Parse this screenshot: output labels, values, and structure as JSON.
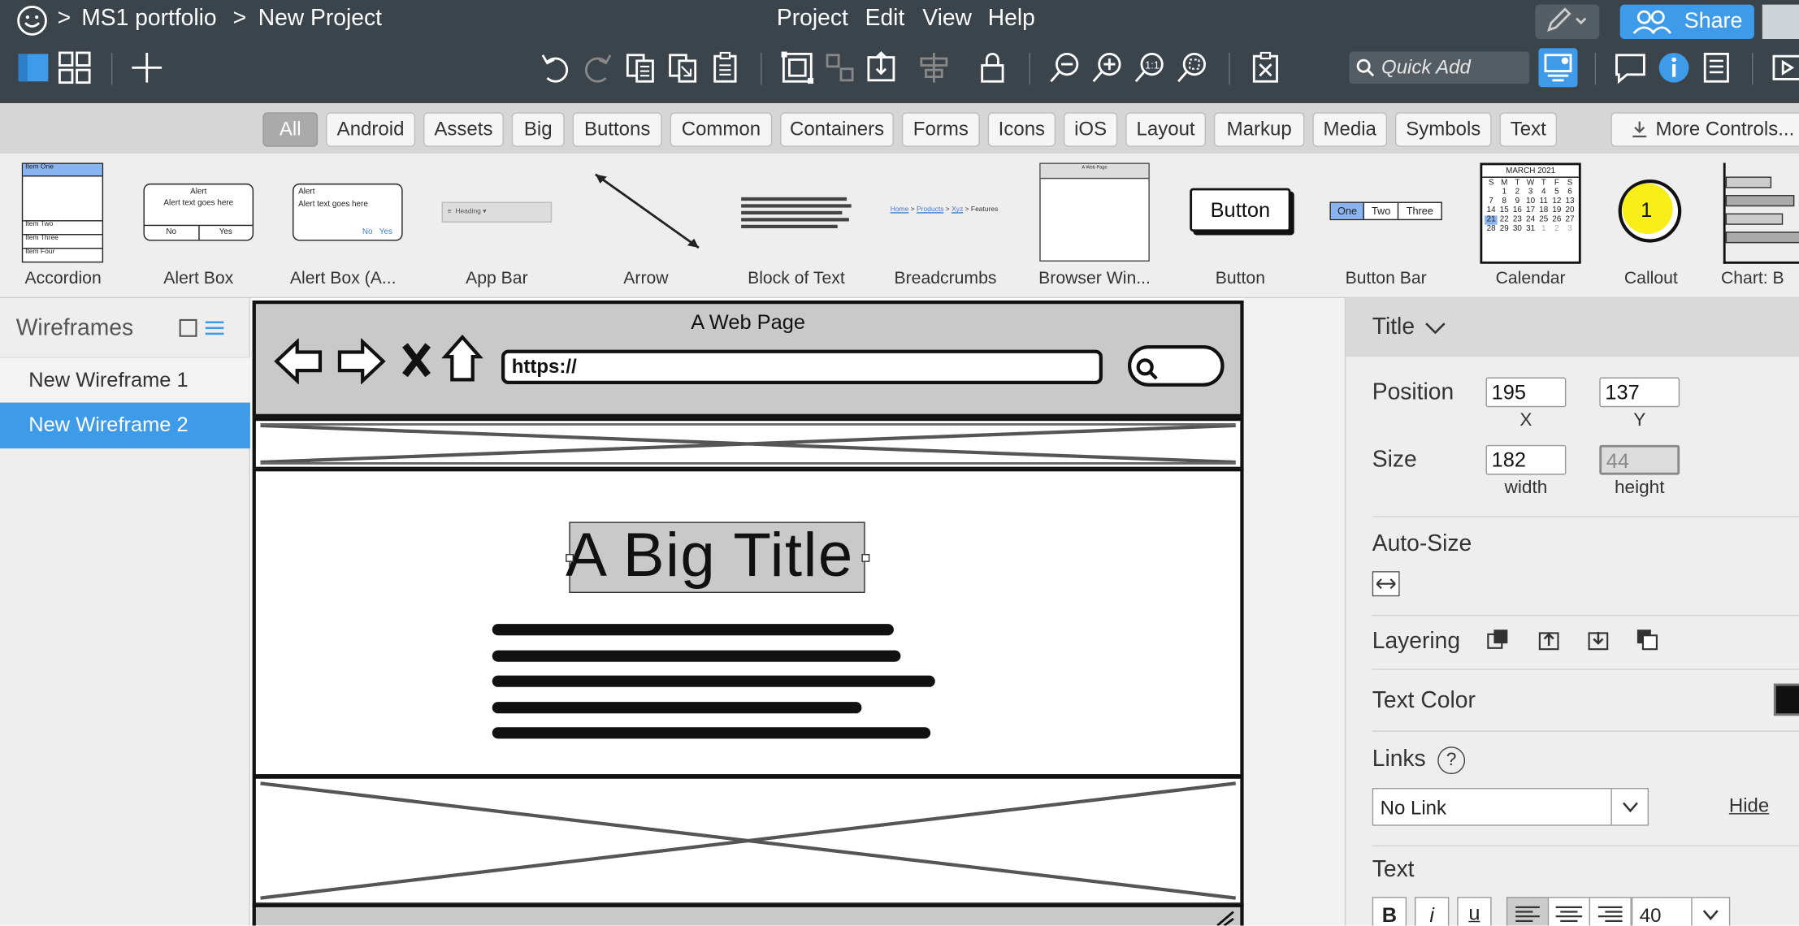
{
  "breadcrumb": {
    "sep1": ">",
    "project": "MS1 portfolio",
    "sep2": ">",
    "current": "New Project"
  },
  "menu": [
    "Project",
    "Edit",
    "View",
    "Help"
  ],
  "share_label": "Share",
  "quick_add_placeholder": "Quick Add",
  "filters": [
    "All",
    "Android",
    "Assets",
    "Big",
    "Buttons",
    "Common",
    "Containers",
    "Forms",
    "Icons",
    "iOS",
    "Layout",
    "Markup",
    "Media",
    "Symbols",
    "Text"
  ],
  "more_controls": "More Controls...",
  "library": {
    "items": [
      "Accordion",
      "Alert Box",
      "Alert Box (A...",
      "App Bar",
      "Arrow",
      "Block of Text",
      "Breadcrumbs",
      "Browser Win...",
      "Button",
      "Button Bar",
      "Calendar",
      "Callout",
      "Chart: B"
    ],
    "accordion_thumb": [
      "Item One",
      "Item Two",
      "Item Three",
      "Item Four"
    ],
    "alert_title": "Alert",
    "alert_text": "Alert text goes here",
    "alert_no": "No",
    "alert_yes": "Yes",
    "appbar_heading": "Heading",
    "breadcrumb_thumb": [
      "Home",
      "Products",
      "Xyz",
      "Features"
    ],
    "browser_thumb_title": "A Web Page",
    "button_thumb": "Button",
    "buttonbar_thumb": [
      "One",
      "Two",
      "Three"
    ],
    "calendar_month": "MARCH 2021",
    "calendar_days": [
      "S",
      "M",
      "T",
      "W",
      "T",
      "F",
      "S"
    ],
    "calendar_nums": [
      "",
      "1",
      "2",
      "3",
      "4",
      "5",
      "6",
      "7",
      "8",
      "9",
      "10",
      "11",
      "12",
      "13",
      "14",
      "15",
      "16",
      "17",
      "18",
      "19",
      "20",
      "21",
      "22",
      "23",
      "24",
      "25",
      "26",
      "27",
      "28",
      "29",
      "30",
      "31",
      "1",
      "2",
      "3"
    ],
    "callout_num": "1"
  },
  "sidebar": {
    "title": "Wireframes",
    "items": [
      "New Wireframe 1",
      "New Wireframe 2"
    ],
    "selected": 1
  },
  "canvas": {
    "page_title": "A Web Page",
    "url": "https://",
    "big_title": "A Big Title"
  },
  "props": {
    "header": "Title",
    "position_label": "Position",
    "x_value": "195",
    "y_value": "137",
    "x_label": "X",
    "y_label": "Y",
    "size_label": "Size",
    "width_value": "182",
    "height_value": "44",
    "width_label": "width",
    "height_label": "height",
    "autosize_label": "Auto-Size",
    "layering_label": "Layering",
    "text_color_label": "Text Color",
    "links_label": "Links",
    "help_glyph": "?",
    "link_value": "No Link",
    "hide_label": "Hide",
    "text_label": "Text",
    "bold": "B",
    "italic": "i",
    "underline": "u",
    "font_size": "40"
  },
  "colors": {
    "topbar": "#3b434b",
    "accent": "#3d9be9",
    "selected_row": "#3d9be9"
  }
}
